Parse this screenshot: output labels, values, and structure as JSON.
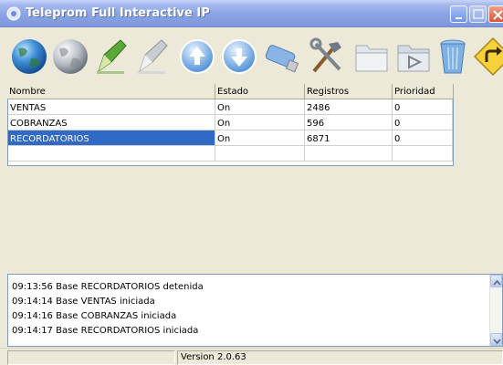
{
  "window": {
    "title": "Teleprom Full Interactive IP"
  },
  "toolbar": {
    "buttons": [
      {
        "icon": "globe-icon"
      },
      {
        "icon": "globe-grey-icon"
      },
      {
        "icon": "pencil-green-icon"
      },
      {
        "icon": "pencil-grey-icon"
      },
      {
        "icon": "arrow-up-icon"
      },
      {
        "icon": "arrow-down-icon"
      },
      {
        "icon": "usb-drive-icon"
      },
      {
        "icon": "tools-icon"
      },
      {
        "icon": "folder-icon"
      },
      {
        "icon": "folder-play-icon"
      },
      {
        "icon": "trash-icon"
      },
      {
        "icon": "exit-sign-icon"
      }
    ]
  },
  "grid": {
    "columns": [
      "Nombre",
      "Estado",
      "Registros",
      "Prioridad"
    ],
    "rows": [
      [
        "VENTAS",
        "On",
        "2486",
        "0"
      ],
      [
        "COBRANZAS",
        "On",
        "596",
        "0"
      ],
      [
        "RECORDATORIOS",
        "On",
        "6871",
        "0"
      ]
    ],
    "selected_row": 2
  },
  "log": {
    "lines": [
      "09:13:56  Base RECORDATORIOS detenida",
      "09:14:14  Base VENTAS iniciada",
      "09:14:16  Base COBRANZAS iniciada",
      "09:14:17  Base RECORDATORIOS iniciada"
    ]
  },
  "status": {
    "version": "Version 2.0.63"
  },
  "colors": {
    "selection": "#3169c6",
    "titlebar": "#8aa3e4"
  }
}
